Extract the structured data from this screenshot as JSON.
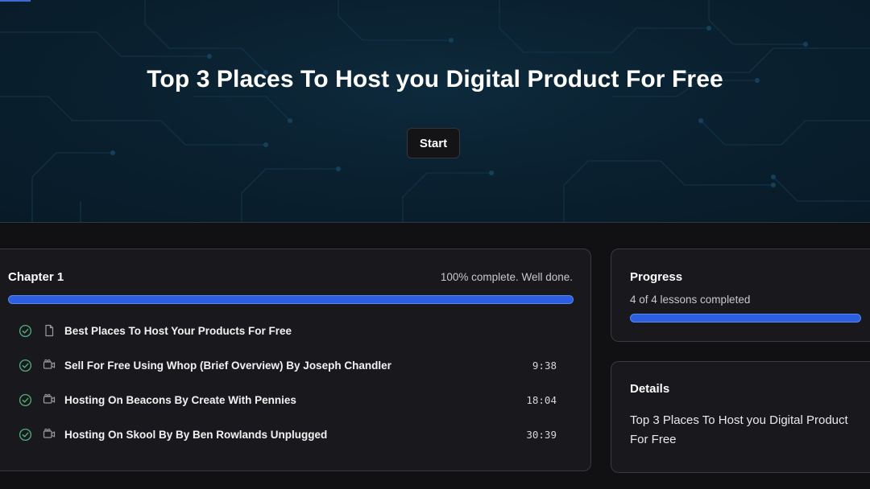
{
  "hero": {
    "title": "Top 3 Places To Host you Digital Product For Free",
    "start_label": "Start"
  },
  "chapter": {
    "title": "Chapter 1",
    "status": "100% complete. Well done.",
    "progress_percent": 100,
    "lessons": [
      {
        "title": "Best Places To Host Your Products For Free",
        "duration": "",
        "type": "document-icon",
        "completed": true
      },
      {
        "title": "Sell For Free Using Whop (Brief Overview) By Joseph Chandler",
        "duration": "9:38",
        "type": "video-icon",
        "completed": true
      },
      {
        "title": "Hosting On Beacons By Create With Pennies",
        "duration": "18:04",
        "type": "video-icon",
        "completed": true
      },
      {
        "title": "Hosting On Skool By By Ben Rowlands Unplugged",
        "duration": "30:39",
        "type": "video-icon",
        "completed": true
      }
    ]
  },
  "progress": {
    "title": "Progress",
    "summary": "4 of 4 lessons completed",
    "percent": 100
  },
  "details": {
    "title": "Details",
    "body": "Top 3 Places To Host you Digital Product For Free"
  },
  "colors": {
    "accent": "#2b5fe0",
    "check": "#4caf7d",
    "background": "#111013",
    "card": "#19181c",
    "hero": "#0a2131"
  }
}
